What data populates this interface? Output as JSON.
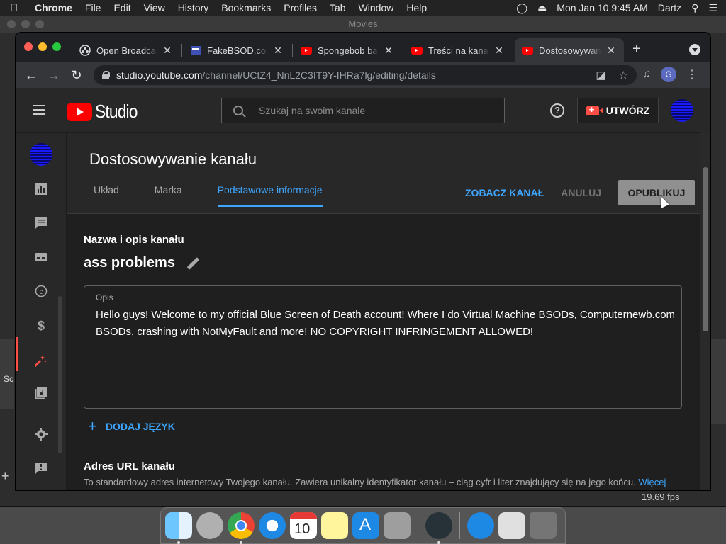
{
  "menubar": {
    "items": [
      "Chrome",
      "File",
      "Edit",
      "View",
      "History",
      "Bookmarks",
      "Profiles",
      "Tab",
      "Window",
      "Help"
    ],
    "datetime": "Mon Jan 10  9:45 AM",
    "user": "Dartz"
  },
  "background_window": {
    "title": "Movies",
    "fps": "19.69 fps",
    "sidebar_fragment": "Sc"
  },
  "browser": {
    "tabs": [
      {
        "title": "Open Broadcaster",
        "favicon": "obs-icon",
        "active": false
      },
      {
        "title": "FakeBSOD.com",
        "favicon": "page-icon",
        "active": false
      },
      {
        "title": "Spongebob battle",
        "favicon": "youtube-icon",
        "active": false
      },
      {
        "title": "Treści na kanale",
        "favicon": "youtube-icon",
        "active": false
      },
      {
        "title": "Dostosowywanie",
        "favicon": "youtube-icon",
        "active": true
      }
    ],
    "url_host": "studio.youtube.com",
    "url_path": "/channel/UCtZ4_NnL2C3IT9Y-IHRa7lg/editing/details",
    "profile_initial": "G"
  },
  "studio": {
    "logo_text": "Studio",
    "search_placeholder": "Szukaj na swoim kanale",
    "create_label": "UTWÓRZ",
    "page_title": "Dostosowywanie kanału",
    "tabs": [
      "Układ",
      "Marka",
      "Podstawowe informacje"
    ],
    "active_tab": "Podstawowe informacje",
    "view_channel": "ZOBACZ KANAŁ",
    "cancel": "ANULUJ",
    "publish": "OPUBLIKUJ",
    "section_name_desc": "Nazwa i opis kanału",
    "channel_name": "ass problems",
    "description_label": "Opis",
    "description_text": "Hello guys! Welcome to my official Blue Screen of Death account! Where I do Virtual Machine BSODs, Computernewb.com BSODs, crashing with NotMyFault and more! NO COPYRIGHT INFRINGEMENT ALLOWED!",
    "add_language": "DODAJ JĘZYK",
    "section_url": "Adres URL kanału",
    "url_desc": "To standardowy adres internetowy Twojego kanału. Zawiera unikalny identyfikator kanału – ciąg cyfr i liter znajdujący się na jego końcu.",
    "url_more": "Więcej"
  },
  "colors": {
    "accent_blue": "#3ea6ff",
    "youtube_red": "#ff0000",
    "active_nav_red": "#ff4e45"
  }
}
